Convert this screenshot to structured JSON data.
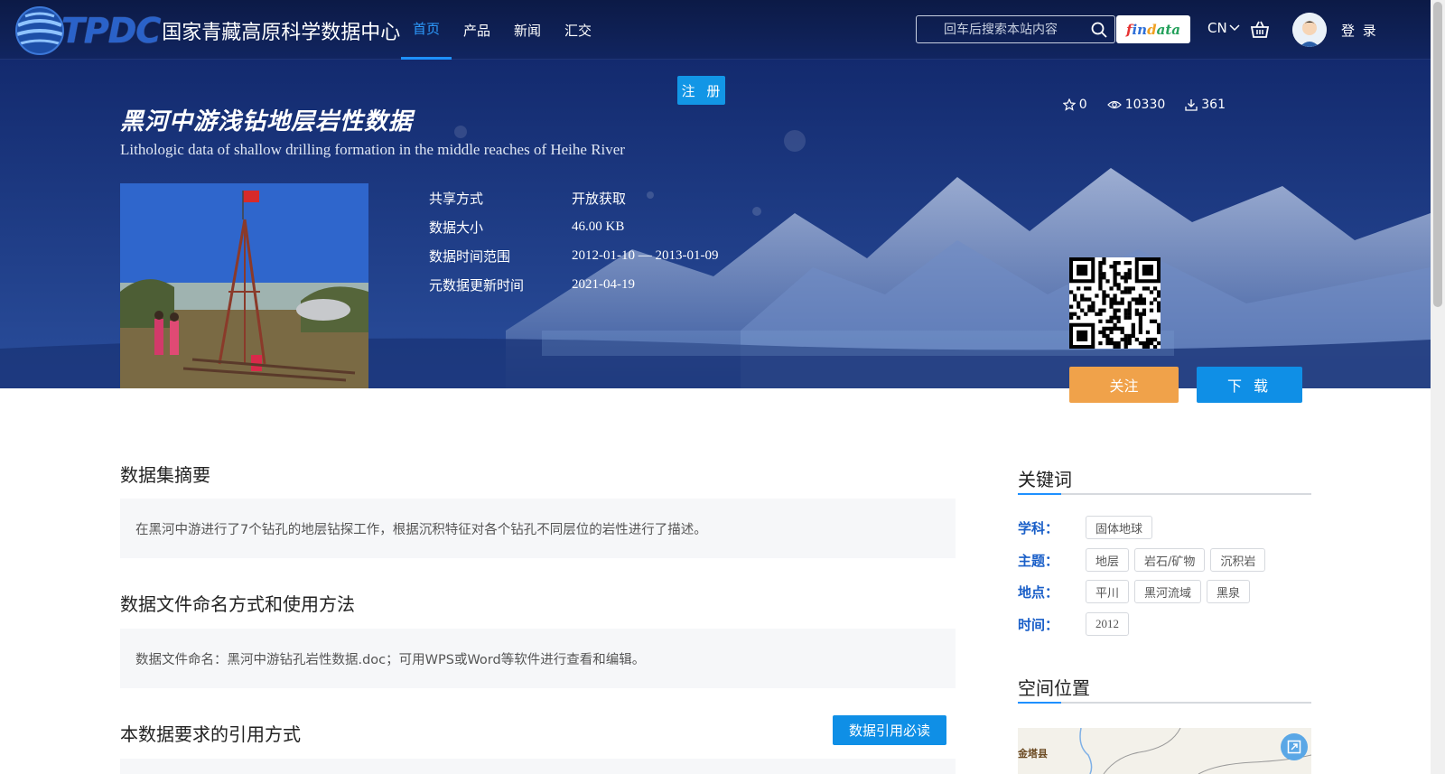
{
  "header": {
    "logo_mark": "TPDC",
    "logo_text": "国家青藏高原科学数据中心",
    "nav": [
      {
        "label": "首页",
        "active": true
      },
      {
        "label": "产品",
        "active": false
      },
      {
        "label": "新闻",
        "active": false
      },
      {
        "label": "汇交",
        "active": false
      }
    ],
    "search_placeholder": "回车后搜索本站内容",
    "findata": [
      "f",
      "in",
      "d",
      "ata"
    ],
    "lang": "CN",
    "login": "登 录"
  },
  "banner": {
    "register": "注 册",
    "title_zh": "黑河中游浅钻地层岩性数据",
    "title_en": "Lithologic data of shallow drilling formation in the middle reaches of Heihe River",
    "stats": {
      "stars": "0",
      "views": "10330",
      "downloads": "361"
    },
    "meta": [
      {
        "label": "共享方式",
        "value": "开放获取"
      },
      {
        "label": "数据大小",
        "value": "46.00 KB"
      },
      {
        "label": "数据时间范围",
        "value": "2012-01-10 — 2013-01-09"
      },
      {
        "label": "元数据更新时间",
        "value": "2021-04-19"
      }
    ],
    "follow": "关注",
    "download": "下 载"
  },
  "main": {
    "abstract_title": "数据集摘要",
    "abstract_text": "在黑河中游进行了7个钻孔的地层钻探工作，根据沉积特征对各个钻孔不同层位的岩性进行了描述。",
    "naming_title": "数据文件命名方式和使用方法",
    "naming_text": "数据文件命名：黑河中游钻孔岩性数据.doc；可用WPS或Word等软件进行查看和编辑。",
    "citation_title": "本数据要求的引用方式",
    "citation_button": "数据引用必读"
  },
  "sidebar": {
    "keywords_title": "关键词",
    "keywords": [
      {
        "label": "学科：",
        "tags": [
          "固体地球"
        ]
      },
      {
        "label": "主题：",
        "tags": [
          "地层",
          "岩石/矿物",
          "沉积岩"
        ]
      },
      {
        "label": "地点：",
        "tags": [
          "平川",
          "黑河流域",
          "黑泉"
        ]
      },
      {
        "label": "时间：",
        "tags": [
          "2012"
        ]
      }
    ],
    "location_title": "空间位置",
    "map_label": "金塔县"
  },
  "colors": {
    "header_bg": "#0c1a46",
    "accent_blue": "#1296e6",
    "follow_orange": "#f0a24a",
    "keyword_label": "#1a5fc8"
  }
}
